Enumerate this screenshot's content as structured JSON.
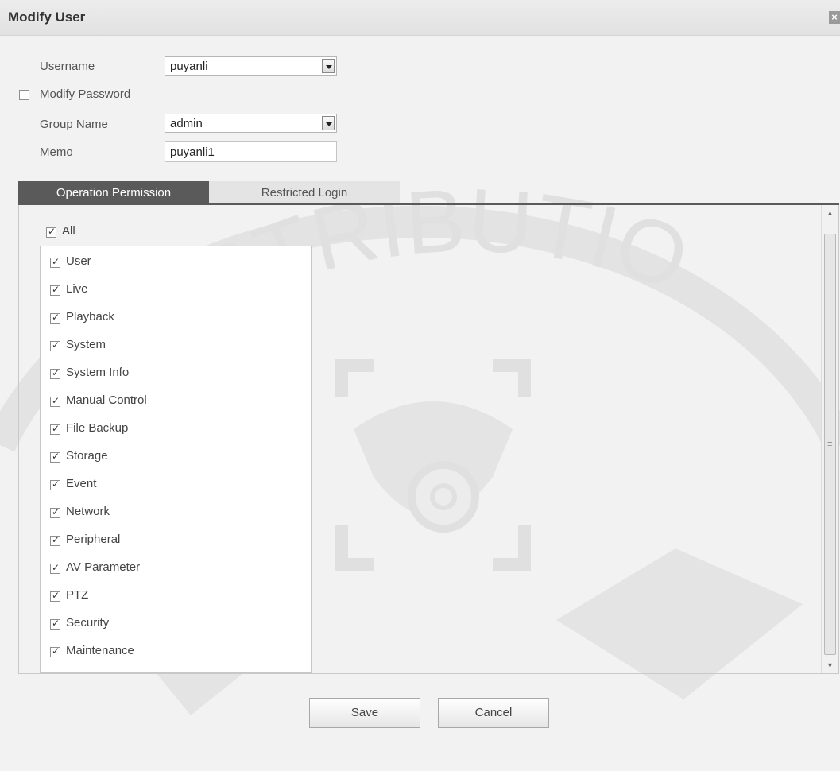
{
  "dialog": {
    "title": "Modify User",
    "close_glyph": "×"
  },
  "form": {
    "username_label": "Username",
    "username_value": "puyanli",
    "modify_password_label": "Modify Password",
    "modify_password_checked": false,
    "group_label": "Group Name",
    "group_value": "admin",
    "memo_label": "Memo",
    "memo_value": "puyanli1"
  },
  "tabs": [
    {
      "label": "Operation Permission",
      "active": true
    },
    {
      "label": "Restricted Login",
      "active": false
    }
  ],
  "permissions": {
    "all_label": "All",
    "all_checked": true,
    "items": [
      {
        "label": "User",
        "checked": true
      },
      {
        "label": "Live",
        "checked": true
      },
      {
        "label": "Playback",
        "checked": true
      },
      {
        "label": "System",
        "checked": true
      },
      {
        "label": "System Info",
        "checked": true
      },
      {
        "label": "Manual Control",
        "checked": true
      },
      {
        "label": "File Backup",
        "checked": true
      },
      {
        "label": "Storage",
        "checked": true
      },
      {
        "label": "Event",
        "checked": true
      },
      {
        "label": "Network",
        "checked": true
      },
      {
        "label": "Peripheral",
        "checked": true
      },
      {
        "label": "AV Parameter",
        "checked": true
      },
      {
        "label": "PTZ",
        "checked": true
      },
      {
        "label": "Security",
        "checked": true
      },
      {
        "label": "Maintenance",
        "checked": true
      }
    ]
  },
  "buttons": {
    "save_label": "Save",
    "cancel_label": "Cancel"
  },
  "watermark": {
    "text": "DISTRIBUTIO"
  },
  "colors": {
    "active_tab": "#5a5a5a",
    "background": "#f2f2f2"
  }
}
